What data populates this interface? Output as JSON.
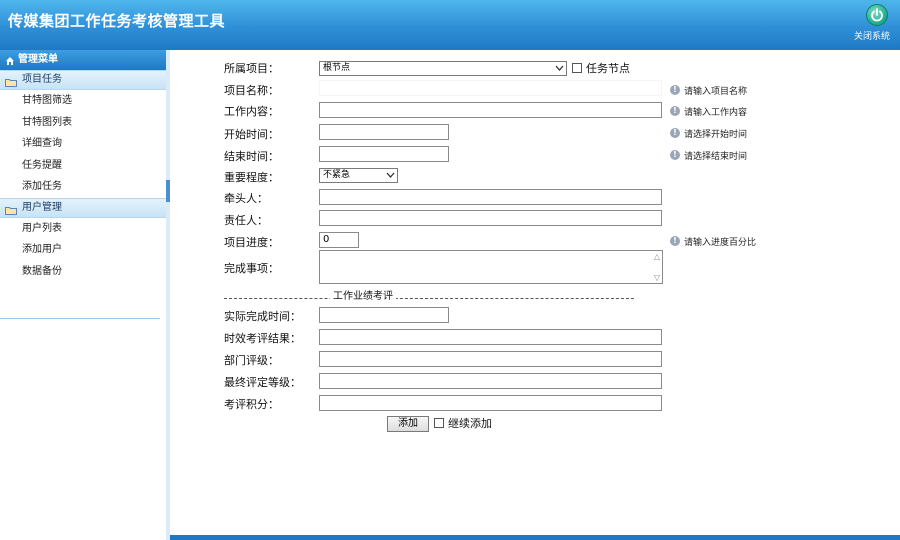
{
  "header": {
    "title": "传媒集团工作任务考核管理工具",
    "close_label": "关闭系统"
  },
  "sidebar": {
    "title": "管理菜单",
    "groups": [
      {
        "label": "项目任务",
        "items": [
          "甘特图筛选",
          "甘特图列表",
          "详细查询",
          "任务提醒",
          "添加任务"
        ]
      },
      {
        "label": "用户管理",
        "items": [
          "用户列表",
          "添加用户",
          "数据备份"
        ]
      }
    ]
  },
  "form": {
    "project_label": "所属项目：",
    "project_selected": "根节点",
    "task_node_label": "任务节点",
    "name_label": "项目名称：",
    "name_hint": "请输入项目名称",
    "content_label": "工作内容：",
    "content_hint": "请输入工作内容",
    "start_label": "开始时间：",
    "start_hint": "请选择开始时间",
    "end_label": "结束时间：",
    "end_hint": "请选择结束时间",
    "importance_label": "重要程度：",
    "importance_selected": "不紧急",
    "leader_label": "牵头人：",
    "owner_label": "责任人：",
    "progress_label": "项目进度：",
    "progress_value": "0",
    "progress_hint": "请输入进度百分比",
    "done_label": "完成事项：",
    "section_title": "工作业绩考评",
    "actual_label": "实际完成时间：",
    "timeliness_label": "时效考评结果：",
    "dept_label": "部门评级：",
    "final_label": "最终评定等级：",
    "score_label": "考评积分：",
    "add_button": "添加",
    "continue_label": "继续添加"
  }
}
